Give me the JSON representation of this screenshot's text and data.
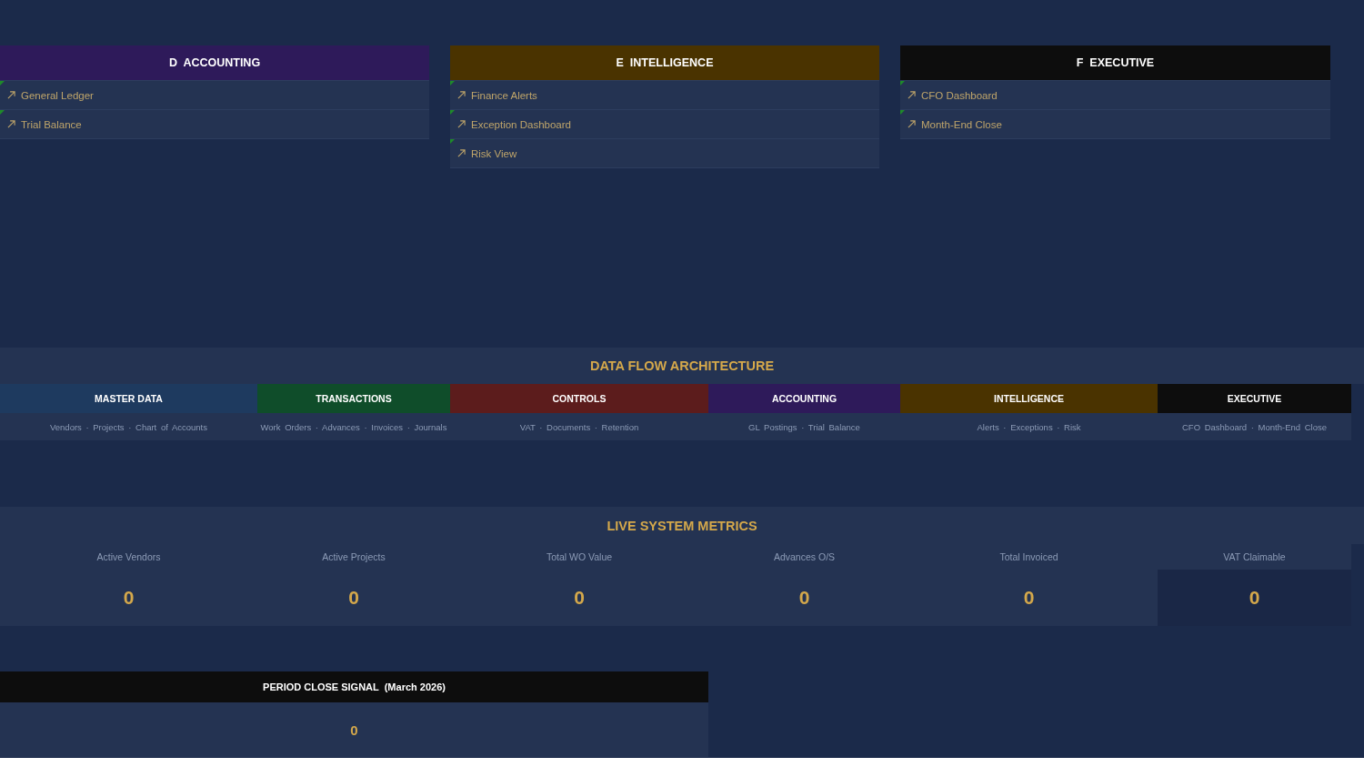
{
  "modules": [
    {
      "title": "D  ACCOUNTING",
      "color": "#2e1a5a",
      "links": [
        "General Ledger",
        "Trial Balance"
      ]
    },
    {
      "title": "E  INTELLIGENCE",
      "color": "#4a3300",
      "links": [
        "Finance Alerts",
        "Exception Dashboard",
        "Risk View"
      ]
    },
    {
      "title": "F  EXECUTIVE",
      "color": "#0d0d0d",
      "links": [
        "CFO Dashboard",
        "Month-End Close"
      ]
    }
  ],
  "data_flow": {
    "title": "DATA FLOW ARCHITECTURE",
    "stages": [
      {
        "name": "MASTER DATA",
        "color": "#1e3a5f",
        "items": "Vendors · Projects · Chart of Accounts"
      },
      {
        "name": "TRANSACTIONS",
        "color": "#0f4d2a",
        "items": "Work Orders · Advances · Invoices · Journals"
      },
      {
        "name": "CONTROLS",
        "color": "#5c1c1c",
        "items": "VAT · Documents · Retention"
      },
      {
        "name": "ACCOUNTING",
        "color": "#2e1a5a",
        "items": "GL Postings · Trial Balance"
      },
      {
        "name": "INTELLIGENCE",
        "color": "#4a3300",
        "items": "Alerts · Exceptions · Risk"
      },
      {
        "name": "EXECUTIVE",
        "color": "#0d0d0d",
        "items": "CFO Dashboard · Month-End Close"
      }
    ]
  },
  "live_metrics": {
    "title": "LIVE SYSTEM METRICS",
    "items": [
      {
        "label": "Active Vendors",
        "value": "0",
        "filled": true
      },
      {
        "label": "Active Projects",
        "value": "0",
        "filled": true
      },
      {
        "label": "Total WO Value",
        "value": "0",
        "filled": true
      },
      {
        "label": "Advances O/S",
        "value": "0",
        "filled": true
      },
      {
        "label": "Total Invoiced",
        "value": "0",
        "filled": true
      },
      {
        "label": "VAT Claimable",
        "value": "0",
        "filled": false
      }
    ]
  },
  "period_close": {
    "title": "PERIOD CLOSE SIGNAL  (March 2026)",
    "value": "0"
  }
}
